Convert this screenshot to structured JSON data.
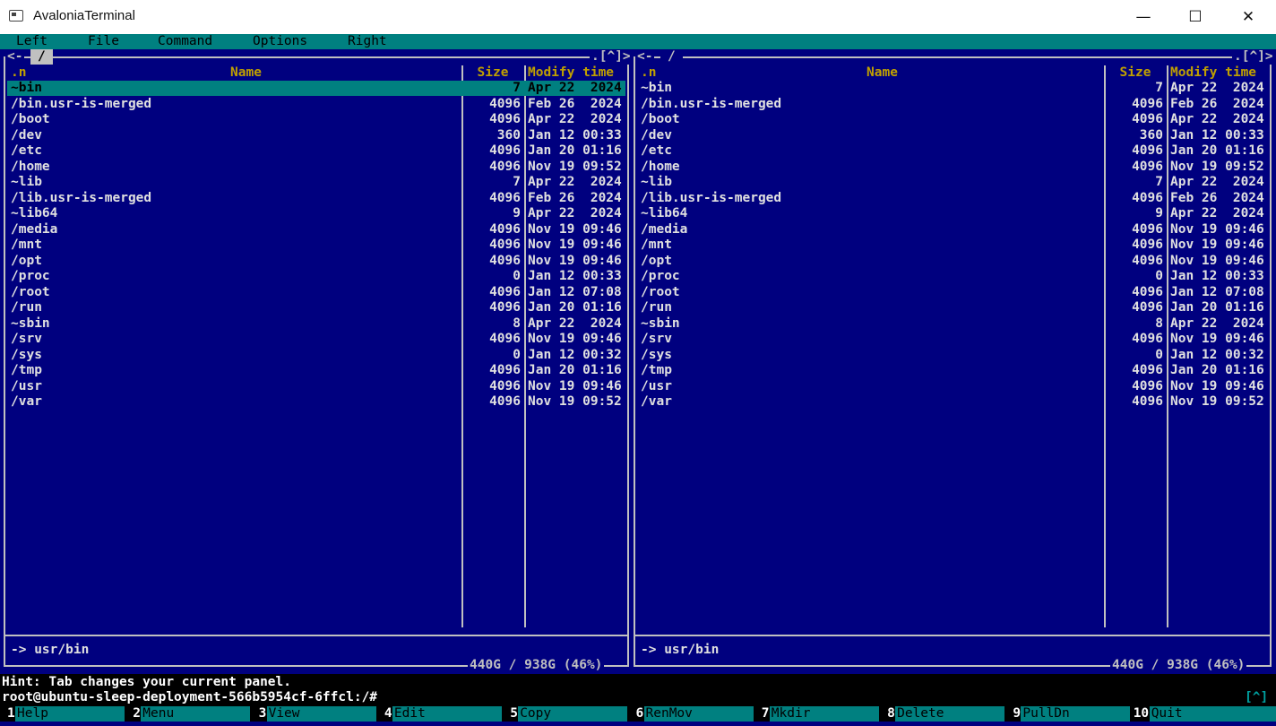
{
  "window": {
    "title": "AvaloniaTerminal",
    "minimize_glyph": "—",
    "maximize_glyph": "☐",
    "close_glyph": "✕"
  },
  "menu": [
    "Left",
    "File",
    "Command",
    "Options",
    "Right"
  ],
  "left_panel": {
    "path": "/",
    "nav_left": "<-",
    "nav_right": ".[^]>",
    "col_n": ".n",
    "col_name": "Name",
    "col_size": "Size",
    "col_time": "Modify time",
    "info": "-> usr/bin",
    "disk": "440G / 938G (46%)"
  },
  "right_panel": {
    "path": "/",
    "nav_left": "<-",
    "nav_right": ".[^]>",
    "col_n": ".n",
    "col_name": "Name",
    "col_size": "Size",
    "col_time": "Modify time",
    "info": "-> usr/bin",
    "disk": "440G / 938G (46%)"
  },
  "files": [
    {
      "name": "~bin",
      "size": "7",
      "time": "Apr 22  2024"
    },
    {
      "name": "/bin.usr-is-merged",
      "size": "4096",
      "time": "Feb 26  2024"
    },
    {
      "name": "/boot",
      "size": "4096",
      "time": "Apr 22  2024"
    },
    {
      "name": "/dev",
      "size": "360",
      "time": "Jan 12 00:33"
    },
    {
      "name": "/etc",
      "size": "4096",
      "time": "Jan 20 01:16"
    },
    {
      "name": "/home",
      "size": "4096",
      "time": "Nov 19 09:52"
    },
    {
      "name": "~lib",
      "size": "7",
      "time": "Apr 22  2024"
    },
    {
      "name": "/lib.usr-is-merged",
      "size": "4096",
      "time": "Feb 26  2024"
    },
    {
      "name": "~lib64",
      "size": "9",
      "time": "Apr 22  2024"
    },
    {
      "name": "/media",
      "size": "4096",
      "time": "Nov 19 09:46"
    },
    {
      "name": "/mnt",
      "size": "4096",
      "time": "Nov 19 09:46"
    },
    {
      "name": "/opt",
      "size": "4096",
      "time": "Nov 19 09:46"
    },
    {
      "name": "/proc",
      "size": "0",
      "time": "Jan 12 00:33"
    },
    {
      "name": "/root",
      "size": "4096",
      "time": "Jan 12 07:08"
    },
    {
      "name": "/run",
      "size": "4096",
      "time": "Jan 20 01:16"
    },
    {
      "name": "~sbin",
      "size": "8",
      "time": "Apr 22  2024"
    },
    {
      "name": "/srv",
      "size": "4096",
      "time": "Nov 19 09:46"
    },
    {
      "name": "/sys",
      "size": "0",
      "time": "Jan 12 00:32"
    },
    {
      "name": "/tmp",
      "size": "4096",
      "time": "Jan 20 01:16"
    },
    {
      "name": "/usr",
      "size": "4096",
      "time": "Nov 19 09:46"
    },
    {
      "name": "/var",
      "size": "4096",
      "time": "Nov 19 09:52"
    }
  ],
  "hint": "Hint: Tab changes your current panel.",
  "prompt": "root@ubuntu-sleep-deployment-566b5954cf-6ffcl:/#",
  "prompt_right": "[^]",
  "fkeys": [
    {
      "num": "1",
      "label": "Help"
    },
    {
      "num": "2",
      "label": "Menu"
    },
    {
      "num": "3",
      "label": "View"
    },
    {
      "num": "4",
      "label": "Edit"
    },
    {
      "num": "5",
      "label": "Copy"
    },
    {
      "num": "6",
      "label": "RenMov"
    },
    {
      "num": "7",
      "label": "Mkdir"
    },
    {
      "num": "8",
      "label": "Delete"
    },
    {
      "num": "9",
      "label": "PullDn"
    },
    {
      "num": "10",
      "label": "Quit"
    }
  ],
  "colors": {
    "panel_bg": "#00007f",
    "accent": "#008080",
    "header": "#c0a000"
  }
}
